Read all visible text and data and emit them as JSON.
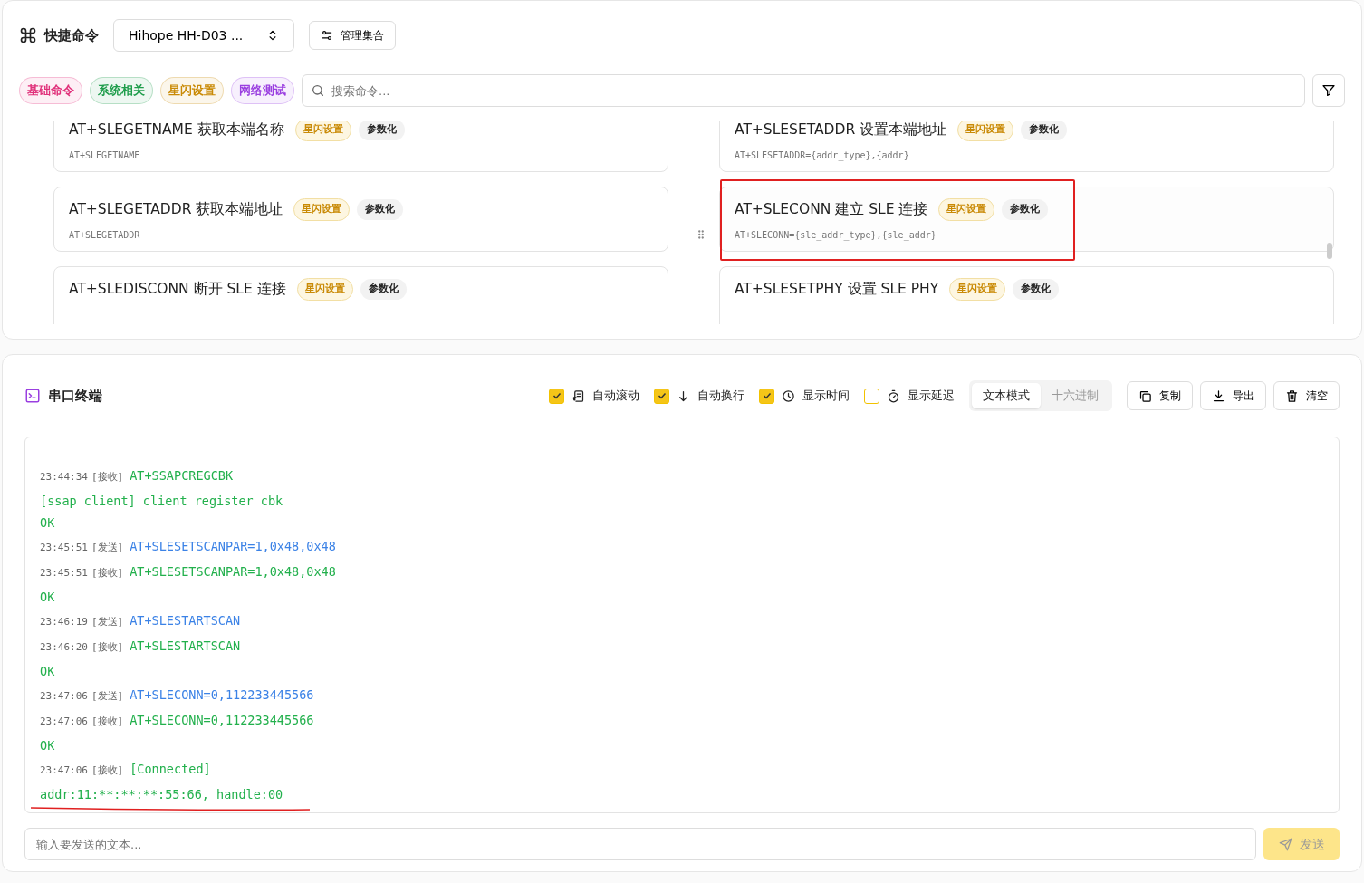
{
  "quick_commands": {
    "title": "快捷命令",
    "collection": "Hihope HH-D03 ...",
    "manage_button": "管理集合",
    "categories": [
      {
        "label": "基础命令",
        "color": "#e0307a"
      },
      {
        "label": "系统相关",
        "color": "#1f9d4c"
      },
      {
        "label": "星闪设置",
        "color": "#c98a06"
      },
      {
        "label": "网络测试",
        "color": "#9a3fe0"
      }
    ],
    "search": {
      "placeholder": "搜索命令..."
    },
    "commands": [
      {
        "title": "AT+SLEGETNAME 获取本端名称",
        "tag": "星闪设置",
        "param": "参数化",
        "code": "AT+SLEGETNAME",
        "highlighted": false
      },
      {
        "title": "AT+SLESETADDR 设置本端地址",
        "tag": "星闪设置",
        "param": "参数化",
        "code": "AT+SLESETADDR={addr_type},{addr}",
        "highlighted": false
      },
      {
        "title": "AT+SLEGETADDR 获取本端地址",
        "tag": "星闪设置",
        "param": "参数化",
        "code": "AT+SLEGETADDR",
        "highlighted": false
      },
      {
        "title": "AT+SLECONN 建立 SLE 连接",
        "tag": "星闪设置",
        "param": "参数化",
        "code": "AT+SLECONN={sle_addr_type},{sle_addr}",
        "highlighted": true
      },
      {
        "title": "AT+SLEDISCONN 断开 SLE 连接",
        "tag": "星闪设置",
        "param": "参数化",
        "highlighted": false
      },
      {
        "title": "AT+SLESETPHY 设置 SLE PHY",
        "tag": "星闪设置",
        "param": "参数化",
        "highlighted": false
      }
    ]
  },
  "terminal": {
    "title": "串口终端",
    "options": [
      {
        "label": "自动滚动",
        "checked": true,
        "kind": "scroll"
      },
      {
        "label": "自动换行",
        "checked": true,
        "kind": "wrap"
      },
      {
        "label": "显示时间",
        "checked": true,
        "kind": "clock"
      },
      {
        "label": "显示延迟",
        "checked": false,
        "kind": "timer"
      }
    ],
    "modes": [
      {
        "label": "文本模式",
        "selected": true
      },
      {
        "label": "十六进制",
        "selected": false
      }
    ],
    "actions": [
      {
        "label": "复制",
        "kind": "copy"
      },
      {
        "label": "导出",
        "kind": "export"
      },
      {
        "label": "清空",
        "kind": "clear"
      }
    ],
    "log": [
      {
        "kind": "entry",
        "time": "23:44:34",
        "dir": "[接收]",
        "color": "#22b04c",
        "text": "AT+SSAPCREGCBK"
      },
      {
        "kind": "plain",
        "text": "[ssap client] client register cbk"
      },
      {
        "kind": "plain",
        "text": "OK"
      },
      {
        "kind": "entry",
        "time": "23:45:51",
        "dir": "[发送]",
        "color": "#3b82e6",
        "text": "AT+SLESETSCANPAR=1,0x48,0x48"
      },
      {
        "kind": "entry",
        "time": "23:45:51",
        "dir": "[接收]",
        "color": "#22b04c",
        "text": "AT+SLESETSCANPAR=1,0x48,0x48"
      },
      {
        "kind": "plain",
        "text": "OK"
      },
      {
        "kind": "entry",
        "time": "23:46:19",
        "dir": "[发送]",
        "color": "#3b82e6",
        "text": "AT+SLESTARTSCAN"
      },
      {
        "kind": "entry",
        "time": "23:46:20",
        "dir": "[接收]",
        "color": "#22b04c",
        "text": "AT+SLESTARTSCAN"
      },
      {
        "kind": "plain",
        "text": "OK"
      },
      {
        "kind": "entry",
        "time": "23:47:06",
        "dir": "[发送]",
        "color": "#3b82e6",
        "text": "AT+SLECONN=0,112233445566"
      },
      {
        "kind": "entry",
        "time": "23:47:06",
        "dir": "[接收]",
        "color": "#22b04c",
        "text": "AT+SLECONN=0,112233445566"
      },
      {
        "kind": "plain",
        "text": "OK"
      },
      {
        "kind": "entry",
        "time": "23:47:06",
        "dir": "[接收]",
        "color": "#22b04c",
        "text": "[Connected]"
      },
      {
        "kind": "plain",
        "text": "addr:11:**:**:**:55:66, handle:00",
        "underlined": true
      }
    ],
    "input": {
      "placeholder": "输入要发送的文本..."
    },
    "send_button": {
      "label": "发送",
      "disabled": true
    }
  }
}
